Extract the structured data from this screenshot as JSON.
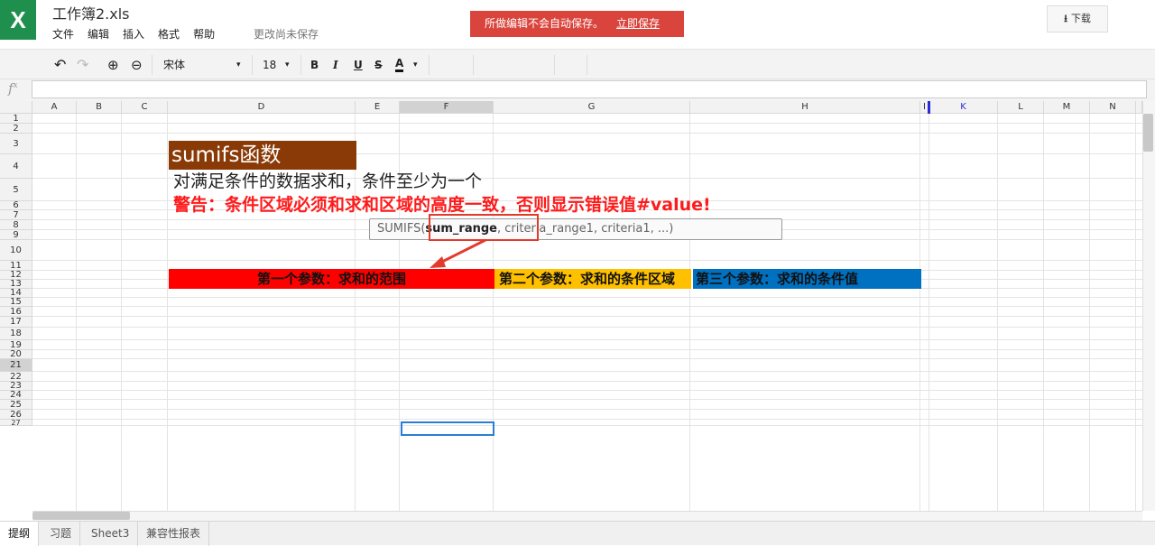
{
  "app": {
    "logo_letter": "X",
    "doc_title": "工作簿2.xls"
  },
  "menu": [
    "文件",
    "编辑",
    "插入",
    "格式",
    "帮助"
  ],
  "save_status": "更改尚未保存",
  "alert": {
    "message": "所做编辑不会自动保存。",
    "action": "立即保存",
    "color": "#d9453d"
  },
  "download": {
    "icon": "download-icon",
    "label": "下载"
  },
  "toolbar": {
    "undo": "↶",
    "redo": "↷",
    "zoom_in": "⊕",
    "zoom_out": "⊖",
    "font_name": "宋体",
    "font_size": "18",
    "bold": "B",
    "italic": "I",
    "underline": "U",
    "strike": "S",
    "font_color": "A",
    "caret": "▾"
  },
  "formula_bar": {
    "fx": "fx",
    "value": ""
  },
  "columns": [
    "A",
    "B",
    "C",
    "D",
    "E",
    "F",
    "G",
    "H",
    "I",
    "K",
    "L",
    "M",
    "N"
  ],
  "selected_column": "F",
  "rows": [
    "1",
    "2",
    "3",
    "4",
    "5",
    "6",
    "7",
    "8",
    "9",
    "10",
    "11",
    "12",
    "13",
    "14",
    "15",
    "16",
    "17",
    "18",
    "19",
    "20",
    "21",
    "22",
    "23",
    "24",
    "25",
    "26",
    "27"
  ],
  "selected_row": "21",
  "cells": {
    "title": "sumifs函数",
    "description": "对满足条件的数据求和，条件至少为一个",
    "warning": "警告：条件区域必须和求和区域的高度一致，否则显示错误值#value!",
    "param1": "第一个参数：求和的范围",
    "param2": "第二个参数：求和的条件区域",
    "param3": "第三个参数：求和的条件值"
  },
  "tooltip": {
    "prefix": "SUMIFS(",
    "bold": "sum_range",
    "rest": ", criteria_range1, criteria1, ...)"
  },
  "colors": {
    "title_bg": "#8a3a06",
    "param1_bg": "#ff0000",
    "param2_bg": "#ffc000",
    "param3_bg": "#0070c0",
    "warning_text": "#ff1a1a",
    "accent_green": "#1f8f4e"
  },
  "sheet_tabs": [
    "提纲",
    "习题",
    "Sheet3",
    "兼容性报表"
  ],
  "active_tab": "提纲"
}
